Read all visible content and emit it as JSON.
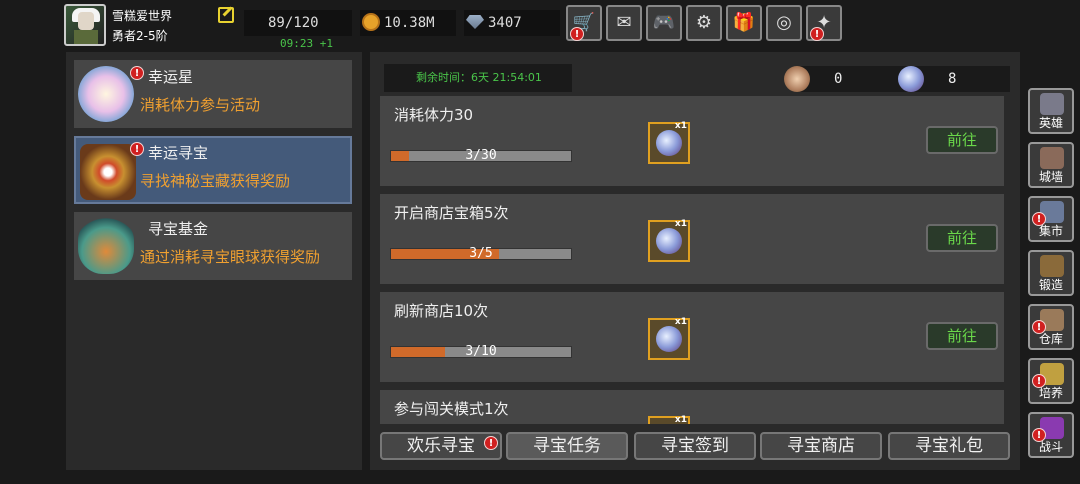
{
  "player": {
    "name": "雪糕爱世界",
    "rank": "勇者2-5阶"
  },
  "resources": {
    "energy": "89/120",
    "energy_timer": "09:23 +1",
    "gold": "10.38M",
    "gems": "3407"
  },
  "topbar_buttons": [
    {
      "name": "shop",
      "glyph": "🛒",
      "badge": "!"
    },
    {
      "name": "mail",
      "glyph": "✉",
      "badge": ""
    },
    {
      "name": "gamepad",
      "glyph": "🎮",
      "badge": ""
    },
    {
      "name": "settings",
      "glyph": "⚙",
      "badge": ""
    },
    {
      "name": "gift",
      "glyph": "🎁",
      "badge": ""
    },
    {
      "name": "wheel",
      "glyph": "◎",
      "badge": ""
    },
    {
      "name": "event",
      "glyph": "✦",
      "badge": "!"
    }
  ],
  "activities": [
    {
      "title": "幸运星",
      "desc": "消耗体力参与活动",
      "badge": "!"
    },
    {
      "title": "幸运寻宝",
      "desc": "寻找神秘宝藏获得奖励",
      "badge": "!"
    },
    {
      "title": "寻宝基金",
      "desc": "通过消耗寻宝眼球获得奖励",
      "badge": ""
    }
  ],
  "main": {
    "remaining_time": "剩余时间：6天 21:54:01",
    "counter_1": "0",
    "counter_2": "8"
  },
  "tasks": [
    {
      "title": "消耗体力30",
      "progress_text": "3/30",
      "progress": 0.1,
      "reward_count": "x1",
      "button": "前往"
    },
    {
      "title": "开启商店宝箱5次",
      "progress_text": "3/5",
      "progress": 0.6,
      "reward_count": "x1",
      "button": "前往"
    },
    {
      "title": "刷新商店10次",
      "progress_text": "3/10",
      "progress": 0.3,
      "reward_count": "x1",
      "button": "前往"
    },
    {
      "title": "参与闯关模式1次",
      "progress_text": "",
      "progress": 0,
      "reward_count": "x1",
      "button": ""
    }
  ],
  "tabs": [
    {
      "label": "欢乐寻宝",
      "badge": "!"
    },
    {
      "label": "寻宝任务",
      "badge": ""
    },
    {
      "label": "寻宝签到",
      "badge": ""
    },
    {
      "label": "寻宝商店",
      "badge": ""
    },
    {
      "label": "寻宝礼包",
      "badge": ""
    }
  ],
  "right_nav": [
    {
      "label": "英雄",
      "icon": "helmet-icon",
      "badge": ""
    },
    {
      "label": "城墙",
      "icon": "castle-icon",
      "badge": ""
    },
    {
      "label": "集市",
      "icon": "market-icon",
      "badge": "!"
    },
    {
      "label": "锻造",
      "icon": "anvil-icon",
      "badge": ""
    },
    {
      "label": "仓库",
      "icon": "warehouse-icon",
      "badge": "!"
    },
    {
      "label": "培养",
      "icon": "trophy-icon",
      "badge": "!"
    },
    {
      "label": "战斗",
      "icon": "portal-icon",
      "badge": "!"
    }
  ],
  "colors": {
    "accent_orange": "#f0a030",
    "go_green": "#6ad84a",
    "timer_green": "#4ac54a",
    "badge_red": "#d02020",
    "progress_fill": "#d06a2a"
  }
}
